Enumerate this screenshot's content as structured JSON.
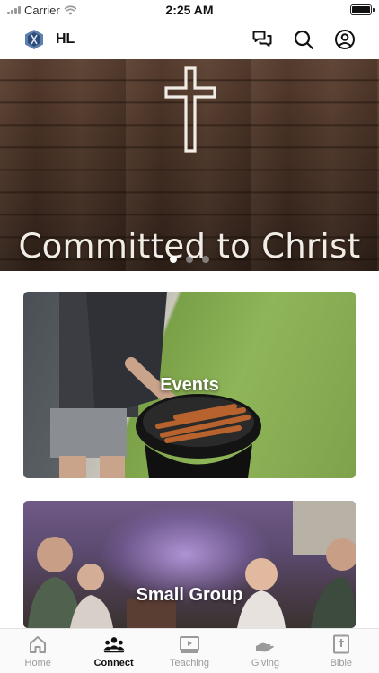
{
  "status_bar": {
    "carrier": "Carrier",
    "time": "2:25 AM"
  },
  "header": {
    "app_name": "HL",
    "icons": [
      "app-logo-icon",
      "chat-icon",
      "search-icon",
      "account-icon"
    ]
  },
  "hero": {
    "title": "Committed to Christ",
    "slide_count": 3,
    "active_slide": 1
  },
  "cards": [
    {
      "label": "Events"
    },
    {
      "label": "Small Group"
    }
  ],
  "tab_bar": {
    "tabs": [
      {
        "label": "Home",
        "icon": "home-icon",
        "active": false
      },
      {
        "label": "Connect",
        "icon": "people-icon",
        "active": true
      },
      {
        "label": "Teaching",
        "icon": "video-icon",
        "active": false
      },
      {
        "label": "Giving",
        "icon": "giving-hand-icon",
        "active": false
      },
      {
        "label": "Bible",
        "icon": "bible-icon",
        "active": false
      }
    ]
  },
  "colors": {
    "active_tab": "#111111",
    "inactive_tab": "#9a9a9a",
    "hero_text": "#f1ede6"
  }
}
